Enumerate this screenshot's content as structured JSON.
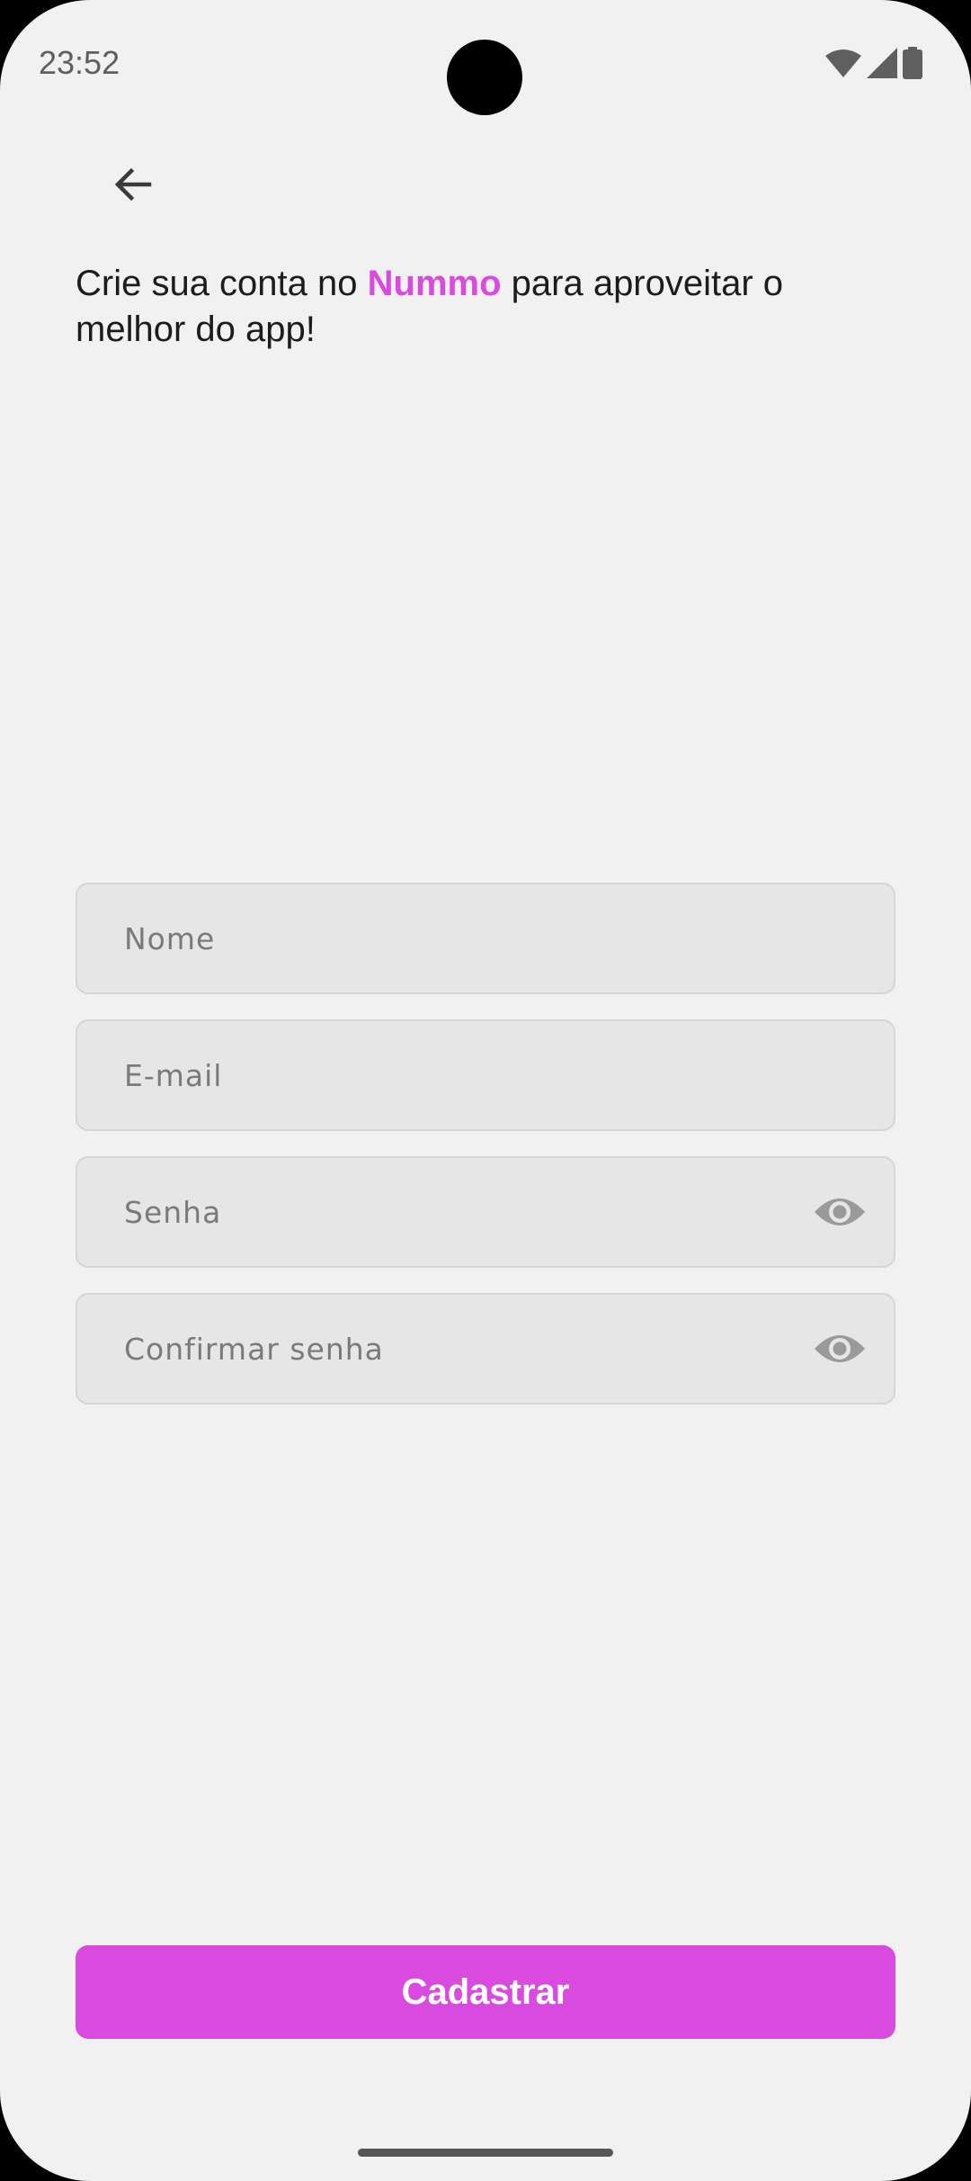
{
  "status_bar": {
    "time": "23:52",
    "icons": [
      "wifi-icon",
      "signal-icon",
      "battery-icon"
    ]
  },
  "header": {
    "back_icon": "arrow-left-icon"
  },
  "headline": {
    "prefix": "Crie sua conta no ",
    "brand": "Nummo",
    "suffix": " para aproveitar o melhor do app!"
  },
  "form": {
    "name": {
      "placeholder": "Nome",
      "value": ""
    },
    "email": {
      "placeholder": "E-mail",
      "value": ""
    },
    "password": {
      "placeholder": "Senha",
      "value": "",
      "toggle_icon": "eye-icon"
    },
    "confirm_password": {
      "placeholder": "Confirmar senha",
      "value": "",
      "toggle_icon": "eye-icon"
    }
  },
  "actions": {
    "submit_label": "Cadastrar"
  },
  "colors": {
    "background": "#f1f1f1",
    "accent": "#d94ade",
    "field_background": "#e6e6e6",
    "field_border": "#d6d6d6",
    "placeholder": "#7a7a7a",
    "text": "#1c1c1c"
  }
}
